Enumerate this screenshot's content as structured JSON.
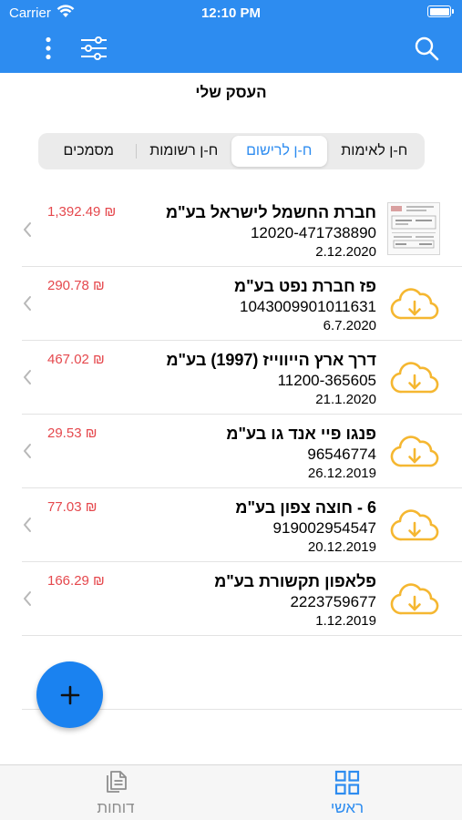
{
  "status_bar": {
    "carrier": "Carrier",
    "time": "12:10 PM"
  },
  "header": {
    "title": "העסק שלי"
  },
  "tabs": [
    {
      "label": "ח-ן לאימות",
      "active": false
    },
    {
      "label": "ח-ן לרישום",
      "active": true
    },
    {
      "label": "ח-ן רשומות",
      "active": false
    },
    {
      "label": "מסמכים",
      "active": false
    }
  ],
  "invoices": [
    {
      "name": "חברת החשמל לישראל בע\"מ",
      "number": "12020-471738890",
      "date": "2.12.2020",
      "amount": "1,392.49 ₪",
      "thumb": "invoice-image"
    },
    {
      "name": "פז חברת נפט בע\"מ",
      "number": "1043009901011631",
      "date": "6.7.2020",
      "amount": "290.78 ₪",
      "thumb": "cloud-download-icon"
    },
    {
      "name": "דרך ארץ הייווייז (1997) בע\"מ",
      "number": "11200-365605",
      "date": "21.1.2020",
      "amount": "467.02 ₪",
      "thumb": "cloud-download-icon"
    },
    {
      "name": "פנגו פיי אנד גו בע\"מ",
      "number": "96546774",
      "date": "26.12.2019",
      "amount": "29.53 ₪",
      "thumb": "cloud-download-icon"
    },
    {
      "name": "6 - חוצה צפון  בע\"מ",
      "number": "919002954547",
      "date": "20.12.2019",
      "amount": "77.03 ₪",
      "thumb": "cloud-download-icon"
    },
    {
      "name": "פלאפון תקשורת בע\"מ",
      "number": "2223759677",
      "date": "1.12.2019",
      "amount": "166.29 ₪",
      "thumb": "cloud-download-icon"
    }
  ],
  "bottom_tabs": [
    {
      "label": "ראשי",
      "icon": "grid-icon",
      "active": true
    },
    {
      "label": "דוחות",
      "icon": "documents-icon",
      "active": false
    }
  ],
  "colors": {
    "primary": "#2d8cf0",
    "amount": "#e5484d",
    "cloud": "#f5b731",
    "fab": "#1a82f0"
  }
}
